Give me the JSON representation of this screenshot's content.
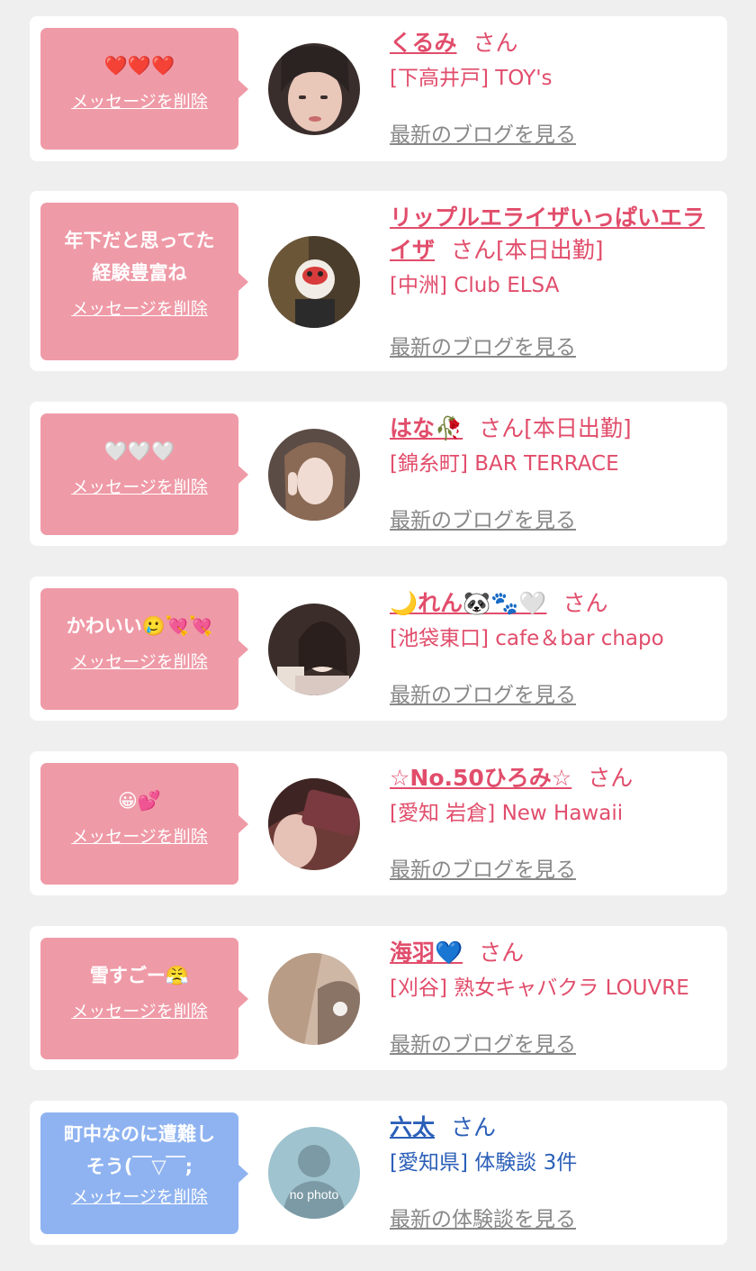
{
  "delete_label": "メッセージを削除",
  "colors": {
    "bubble_pink": "#ef9aa7",
    "bubble_blue": "#8fb3f1",
    "name_pink": "#e14d6b",
    "name_blue": "#2b5fb8"
  },
  "cards": [
    {
      "message": "❤️❤️❤️",
      "name": "くるみ",
      "suffix": "さん",
      "shop": "[下高井戸] TOY's",
      "link": "最新のブログを見る"
    },
    {
      "message": "年下だと思ってた\n経験豊富ね",
      "name": "リップルエライザいっぱいエライザ",
      "suffix": "さん[本日出勤]",
      "shop": "[中洲] Club ELSA",
      "link": "最新のブログを見る"
    },
    {
      "message": "🤍🤍🤍",
      "name": "はな🥀",
      "suffix": "さん[本日出勤]",
      "shop": "[錦糸町] BAR TERRACE",
      "link": "最新のブログを見る"
    },
    {
      "message": "かわいい🥲💘💘",
      "name": "🌙れん🐼🐾🤍",
      "suffix": "さん",
      "shop": "[池袋東口] cafe＆bar chapo",
      "link": "最新のブログを見る"
    },
    {
      "message": "😀💕",
      "name": "☆No.50ひろみ☆",
      "suffix": "さん",
      "shop": "[愛知 岩倉] New Hawaii",
      "link": "最新のブログを見る"
    },
    {
      "message": "雪すごー😤",
      "name": "海羽💙",
      "suffix": "さん",
      "shop": "[刈谷] 熟女キャバクラ LOUVRE",
      "link": "最新のブログを見る"
    },
    {
      "message": "町中なのに遭難し\nそう(￣▽￣;",
      "name": "六太",
      "suffix": "さん",
      "shop": "[愛知県] 体験談 3件",
      "link": "最新の体験談を見る",
      "avatar_text": "no photo"
    }
  ]
}
